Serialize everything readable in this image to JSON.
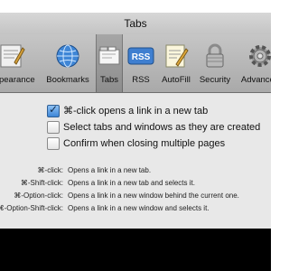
{
  "window": {
    "title": "Tabs"
  },
  "toolbar": {
    "items": [
      {
        "label": "Appearance",
        "icon": "appearance-icon"
      },
      {
        "label": "Bookmarks",
        "icon": "bookmarks-icon"
      },
      {
        "label": "Tabs",
        "icon": "tabs-icon",
        "selected": true
      },
      {
        "label": "RSS",
        "icon": "rss-icon"
      },
      {
        "label": "AutoFill",
        "icon": "autofill-icon"
      },
      {
        "label": "Security",
        "icon": "security-icon"
      },
      {
        "label": "Advanced",
        "icon": "advanced-icon"
      }
    ]
  },
  "options": [
    {
      "label": "⌘-click opens a link in a new tab",
      "checked": true
    },
    {
      "label": "Select tabs and windows as they are created",
      "checked": false
    },
    {
      "label": "Confirm when closing multiple pages",
      "checked": false
    }
  ],
  "shortcuts": [
    {
      "key": "⌘-click:",
      "desc": "Opens a link in a new tab."
    },
    {
      "key": "⌘-Shift-click:",
      "desc": "Opens a link in a new tab and selects it."
    },
    {
      "key": "⌘-Option-click:",
      "desc": "Opens a link in a new window behind the current one."
    },
    {
      "key": "⌘-Option-Shift-click:",
      "desc": "Opens a link in a new window and selects it."
    }
  ]
}
